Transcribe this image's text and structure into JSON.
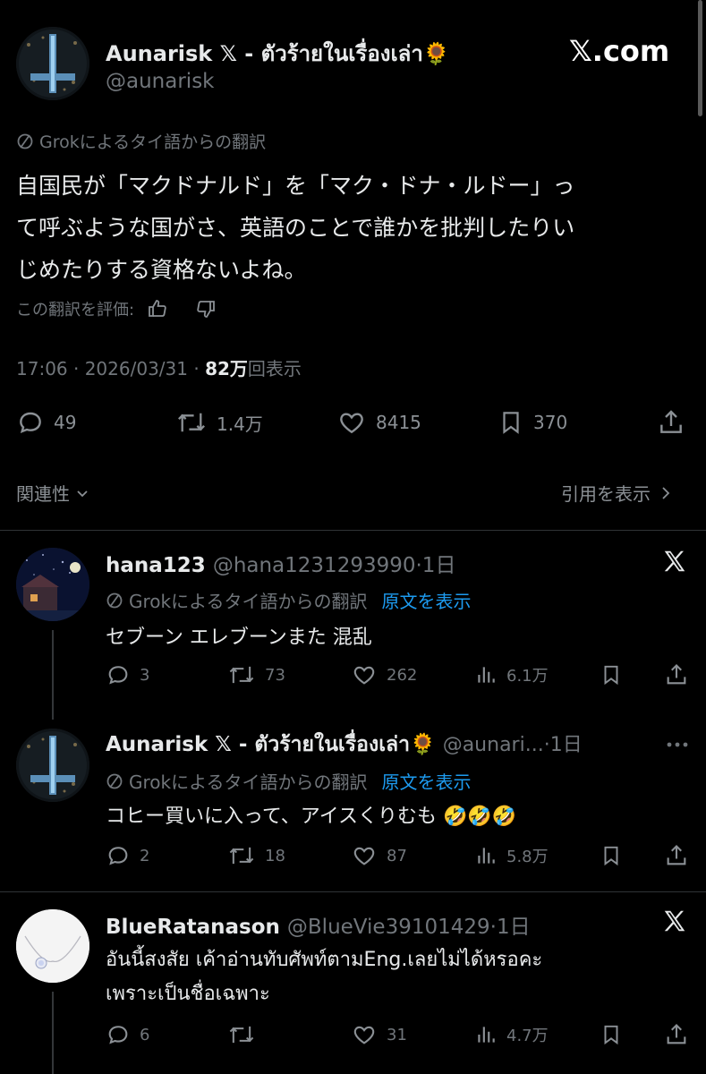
{
  "post": {
    "author_name": "Aunarisk 𝕏 - ตัวร้ายในเรื่องเล่า🌻",
    "handle": "@aunarisk",
    "site_label": "𝕏.com",
    "translation_note": "Grokによるタイ語からの翻訳",
    "text_line1": "自国民が「マクドナルド」を「マク・ドナ・ルドー」っ",
    "text_line2": "て呼ぶような国がさ、英語のことで誰かを批判したりい",
    "text_line3": "じめたりする資格ないよね。",
    "rate_label": "この翻訳を評価:",
    "timestamp": "17:06 · 2026/03/31 · ",
    "views_count": "82万",
    "views_label": "回表示",
    "replies": "49",
    "reposts": "1.4万",
    "likes": "8415",
    "bookmarks": "370",
    "sort_label": "関連性",
    "quotes_label": "引用を表示"
  },
  "replies": [
    {
      "name": "hana123",
      "handle": "@hana1231293990",
      "time": "·1日",
      "translation_note": "Grokによるタイ語からの翻訳",
      "show_original": "原文を表示",
      "text": "セブーン エレブーンまた 混乱",
      "replies": "3",
      "reposts": "73",
      "likes": "262",
      "views": "6.1万"
    },
    {
      "name": "Aunarisk 𝕏 - ตัวร้ายในเรื่องเล่า🌻",
      "handle": "@aunari...",
      "time": "·1日",
      "translation_note": "Grokによるタイ語からの翻訳",
      "show_original": "原文を表示",
      "text": "コヒー買いに入って、アイスくりむも 🤣🤣🤣",
      "replies": "2",
      "reposts": "18",
      "likes": "87",
      "views": "5.8万"
    },
    {
      "name": "BlueRatanason",
      "handle": "@BlueVie39101429",
      "time": "·1日",
      "text_line1": "อันนี้สงสัย เค้าอ่านทับศัพท์ตามEng.เลยไม่ได้หรอคะ",
      "text_line2": "เพราะเป็นชื่อเฉพาะ",
      "replies": "6",
      "reposts": "",
      "likes": "31",
      "views": "4.7万"
    }
  ],
  "icons": {
    "translate": "slashed-circle-icon",
    "x_logo": "x-logo-icon",
    "more": "more-icon"
  }
}
